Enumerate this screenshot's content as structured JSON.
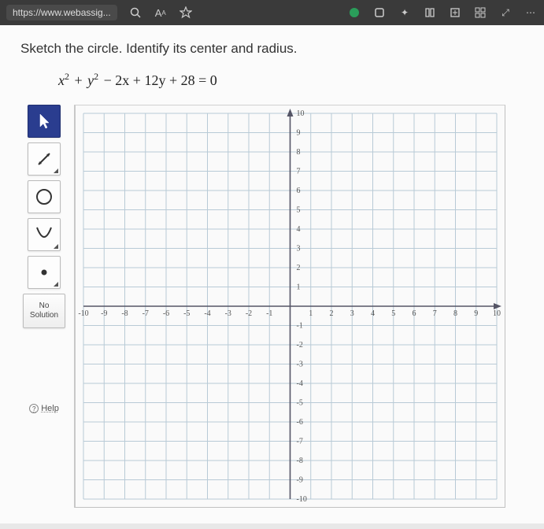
{
  "browser": {
    "url": "https://www.webassig...",
    "icons": [
      "magnify",
      "font-size",
      "star",
      "grammarly",
      "ext1",
      "ext2",
      "reader",
      "collections",
      "grid",
      "ext3",
      "more"
    ]
  },
  "instruction": "Sketch the circle. Identify its center and radius.",
  "equation": {
    "parts": [
      "x",
      "2",
      " + ",
      "y",
      "2",
      " − 2x + 12y + 28 = 0"
    ]
  },
  "toolbar": {
    "pointer": "Pointer",
    "line": "Line",
    "circle": "Circle",
    "parabola": "Parabola",
    "point": "Point",
    "no_solution": "No\nSolution",
    "help": "Help"
  },
  "chart_data": {
    "type": "scatter",
    "title": "",
    "xlabel": "",
    "ylabel": "",
    "xlim": [
      -10,
      10
    ],
    "ylim": [
      -10,
      10
    ],
    "xticks": [
      -10,
      -9,
      -8,
      -7,
      -6,
      -5,
      -4,
      -3,
      -2,
      -1,
      1,
      2,
      3,
      4,
      5,
      6,
      7,
      8,
      9,
      10
    ],
    "yticks": [
      -10,
      -9,
      -8,
      -7,
      -6,
      -5,
      -4,
      -3,
      -2,
      -1,
      1,
      2,
      3,
      4,
      5,
      6,
      7,
      8,
      9,
      10
    ],
    "grid": true,
    "series": []
  }
}
